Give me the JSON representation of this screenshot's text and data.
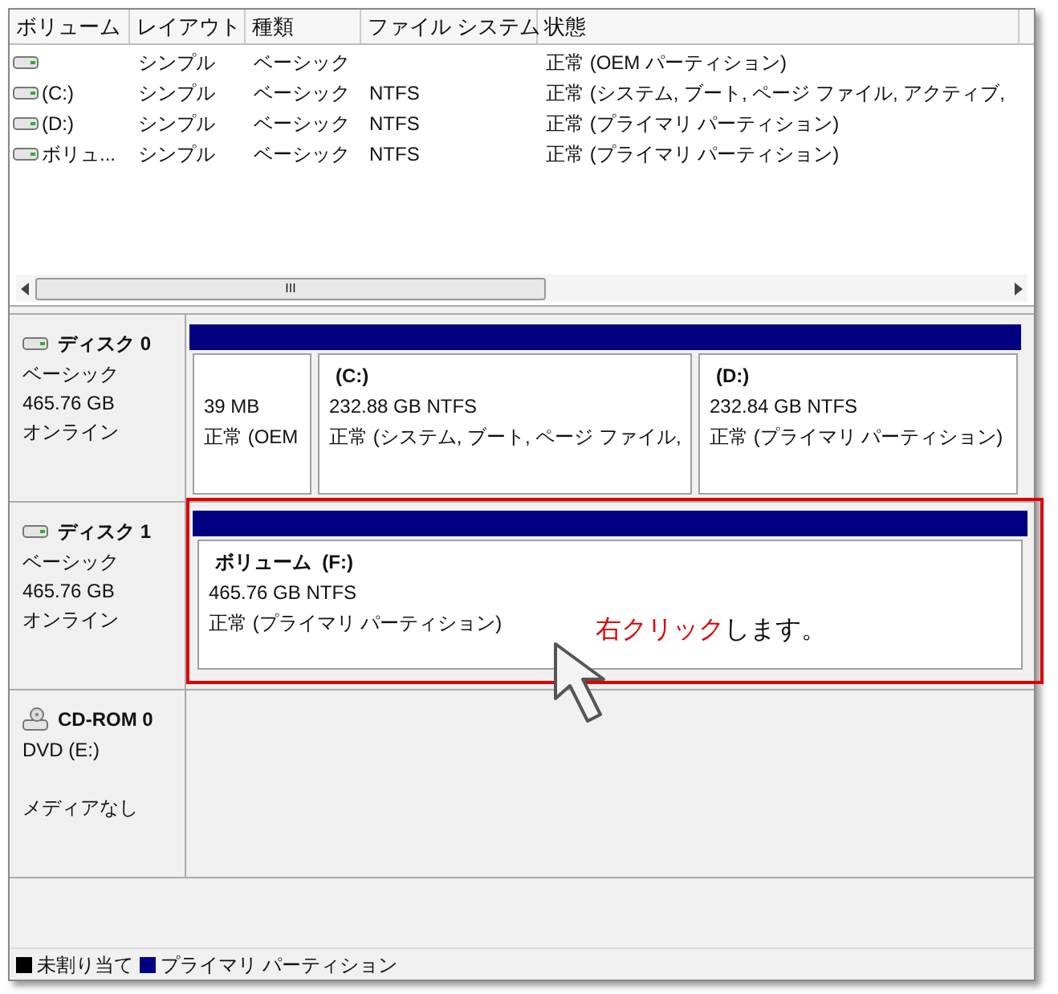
{
  "volume_table": {
    "columns": [
      "ボリューム",
      "レイアウト",
      "種類",
      "ファイル システム",
      "状態"
    ],
    "rows": [
      {
        "layout": "シンプル",
        "type": "ベーシック",
        "status": "正常 (OEM パーティション)"
      },
      {
        "volume": "(C:)",
        "layout": "シンプル",
        "type": "ベーシック",
        "file_system": "NTFS",
        "status": "正常 (システム, ブート, ページ ファイル, アクティブ,"
      },
      {
        "volume": "(D:)",
        "layout": "シンプル",
        "type": "ベーシック",
        "file_system": "NTFS",
        "status": "正常 (プライマリ パーティション)"
      },
      {
        "volume": "ボリュ...",
        "layout": "シンプル",
        "type": "ベーシック",
        "file_system": "NTFS",
        "status": "正常 (プライマリ パーティション)"
      }
    ],
    "scrollbar_label": "III"
  },
  "disks": [
    {
      "kind": "hdd",
      "name": "ディスク 0",
      "lines": [
        "ベーシック",
        "465.76 GB",
        "オンライン"
      ],
      "partitions": [
        {
          "size": "39 MB",
          "status": "正常 (OEM",
          "highlighted": false
        },
        {
          "label": "(C:)",
          "size": "232.88 GB NTFS",
          "status": "正常 (システム, ブート, ページ ファイル,",
          "highlighted": false
        },
        {
          "label": "(D:)",
          "size": "232.84 GB NTFS",
          "status": "正常 (プライマリ パーティション)",
          "highlighted": false
        }
      ]
    },
    {
      "kind": "hdd",
      "name": "ディスク 1",
      "lines": [
        "ベーシック",
        "465.76 GB",
        "オンライン"
      ],
      "partitions": [
        {
          "label": "ボリューム  (F:)",
          "size": "465.76 GB NTFS",
          "status": "正常 (プライマリ パーティション)",
          "highlighted": true
        }
      ]
    },
    {
      "kind": "cdrom",
      "name": "CD-ROM 0",
      "lines": [
        "DVD (E:)",
        "メディアなし"
      ]
    }
  ],
  "annotation": {
    "emphasis": "右クリック",
    "text": "します。"
  },
  "legend": [
    {
      "label": "未割り当て",
      "color": "#000000"
    },
    {
      "label": "プライマリ パーティション",
      "color": "#000080"
    }
  ]
}
